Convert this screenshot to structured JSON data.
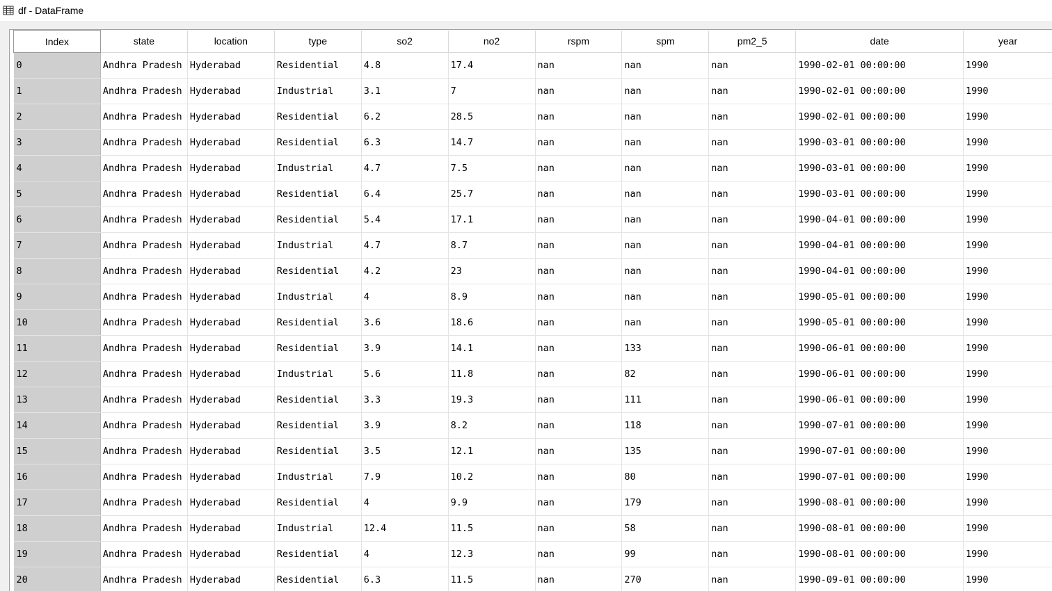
{
  "window": {
    "title": "df - DataFrame",
    "icon": "table-icon"
  },
  "table": {
    "columns": [
      "Index",
      "state",
      "location",
      "type",
      "so2",
      "no2",
      "rspm",
      "spm",
      "pm2_5",
      "date",
      "year"
    ],
    "rows": [
      [
        "0",
        "Andhra Pradesh",
        "Hyderabad",
        "Residential",
        "4.8",
        "17.4",
        "nan",
        "nan",
        "nan",
        "1990-02-01 00:00:00",
        "1990"
      ],
      [
        "1",
        "Andhra Pradesh",
        "Hyderabad",
        "Industrial",
        "3.1",
        "7",
        "nan",
        "nan",
        "nan",
        "1990-02-01 00:00:00",
        "1990"
      ],
      [
        "2",
        "Andhra Pradesh",
        "Hyderabad",
        "Residential",
        "6.2",
        "28.5",
        "nan",
        "nan",
        "nan",
        "1990-02-01 00:00:00",
        "1990"
      ],
      [
        "3",
        "Andhra Pradesh",
        "Hyderabad",
        "Residential",
        "6.3",
        "14.7",
        "nan",
        "nan",
        "nan",
        "1990-03-01 00:00:00",
        "1990"
      ],
      [
        "4",
        "Andhra Pradesh",
        "Hyderabad",
        "Industrial",
        "4.7",
        "7.5",
        "nan",
        "nan",
        "nan",
        "1990-03-01 00:00:00",
        "1990"
      ],
      [
        "5",
        "Andhra Pradesh",
        "Hyderabad",
        "Residential",
        "6.4",
        "25.7",
        "nan",
        "nan",
        "nan",
        "1990-03-01 00:00:00",
        "1990"
      ],
      [
        "6",
        "Andhra Pradesh",
        "Hyderabad",
        "Residential",
        "5.4",
        "17.1",
        "nan",
        "nan",
        "nan",
        "1990-04-01 00:00:00",
        "1990"
      ],
      [
        "7",
        "Andhra Pradesh",
        "Hyderabad",
        "Industrial",
        "4.7",
        "8.7",
        "nan",
        "nan",
        "nan",
        "1990-04-01 00:00:00",
        "1990"
      ],
      [
        "8",
        "Andhra Pradesh",
        "Hyderabad",
        "Residential",
        "4.2",
        "23",
        "nan",
        "nan",
        "nan",
        "1990-04-01 00:00:00",
        "1990"
      ],
      [
        "9",
        "Andhra Pradesh",
        "Hyderabad",
        "Industrial",
        "4",
        "8.9",
        "nan",
        "nan",
        "nan",
        "1990-05-01 00:00:00",
        "1990"
      ],
      [
        "10",
        "Andhra Pradesh",
        "Hyderabad",
        "Residential",
        "3.6",
        "18.6",
        "nan",
        "nan",
        "nan",
        "1990-05-01 00:00:00",
        "1990"
      ],
      [
        "11",
        "Andhra Pradesh",
        "Hyderabad",
        "Residential",
        "3.9",
        "14.1",
        "nan",
        "133",
        "nan",
        "1990-06-01 00:00:00",
        "1990"
      ],
      [
        "12",
        "Andhra Pradesh",
        "Hyderabad",
        "Industrial",
        "5.6",
        "11.8",
        "nan",
        "82",
        "nan",
        "1990-06-01 00:00:00",
        "1990"
      ],
      [
        "13",
        "Andhra Pradesh",
        "Hyderabad",
        "Residential",
        "3.3",
        "19.3",
        "nan",
        "111",
        "nan",
        "1990-06-01 00:00:00",
        "1990"
      ],
      [
        "14",
        "Andhra Pradesh",
        "Hyderabad",
        "Residential",
        "3.9",
        "8.2",
        "nan",
        "118",
        "nan",
        "1990-07-01 00:00:00",
        "1990"
      ],
      [
        "15",
        "Andhra Pradesh",
        "Hyderabad",
        "Residential",
        "3.5",
        "12.1",
        "nan",
        "135",
        "nan",
        "1990-07-01 00:00:00",
        "1990"
      ],
      [
        "16",
        "Andhra Pradesh",
        "Hyderabad",
        "Industrial",
        "7.9",
        "10.2",
        "nan",
        "80",
        "nan",
        "1990-07-01 00:00:00",
        "1990"
      ],
      [
        "17",
        "Andhra Pradesh",
        "Hyderabad",
        "Residential",
        "4",
        "9.9",
        "nan",
        "179",
        "nan",
        "1990-08-01 00:00:00",
        "1990"
      ],
      [
        "18",
        "Andhra Pradesh",
        "Hyderabad",
        "Industrial",
        "12.4",
        "11.5",
        "nan",
        "58",
        "nan",
        "1990-08-01 00:00:00",
        "1990"
      ],
      [
        "19",
        "Andhra Pradesh",
        "Hyderabad",
        "Residential",
        "4",
        "12.3",
        "nan",
        "99",
        "nan",
        "1990-08-01 00:00:00",
        "1990"
      ],
      [
        "20",
        "Andhra Pradesh",
        "Hyderabad",
        "Residential",
        "6.3",
        "11.5",
        "nan",
        "270",
        "nan",
        "1990-09-01 00:00:00",
        "1990"
      ]
    ]
  }
}
